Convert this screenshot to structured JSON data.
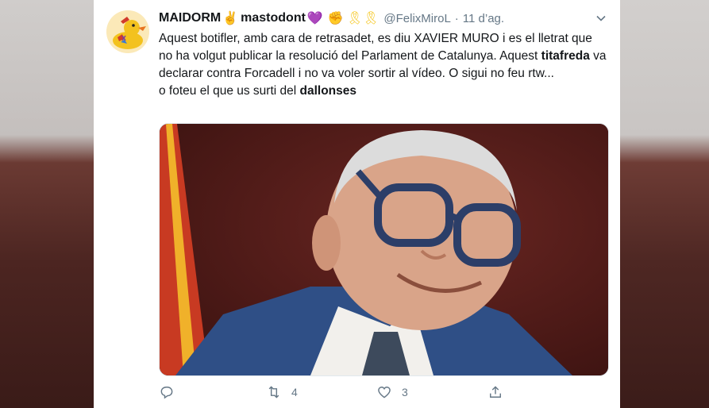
{
  "tweet": {
    "display_name": "MAIDORM",
    "display_name_suffix": "mastodont",
    "emoji_1": "✌",
    "emoji_2": "💜",
    "emoji_3": "✊",
    "emoji_4": "🎗🎗",
    "handle": "@FelixMiroL",
    "separator": "·",
    "timestamp": "11 d’ag.",
    "text_line_1": "Aquest botifler, amb cara de retrasadet, es diu XAVIER MURO i es el lletrat que no ha volgut publicar la resolució del Parlament de Catalunya. Aquest ",
    "text_bold_1": "titafreda",
    "text_line_2": " va declarar contra Forcadell i no va voler sortir al vídeo. O sigui no feu rtw...",
    "text_line_3": "o foteu el que us surti del ",
    "text_bold_2": "dallonses",
    "actions": {
      "reply_icon": "reply-icon",
      "retweet_icon": "retweet-icon",
      "retweet_count": "4",
      "like_icon": "heart-icon",
      "like_count": "3",
      "share_icon": "share-icon"
    }
  },
  "colors": {
    "text_primary": "#14171a",
    "text_secondary": "#657786",
    "background": "#ffffff"
  }
}
